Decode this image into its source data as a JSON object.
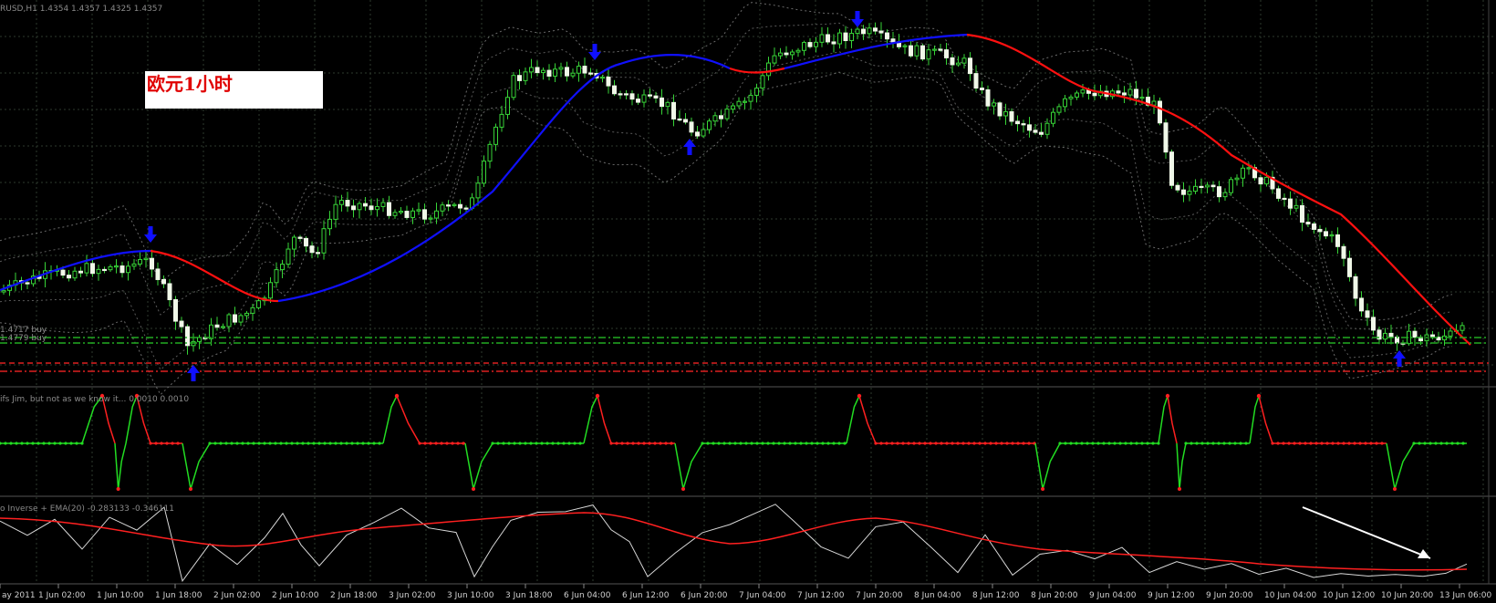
{
  "window": {
    "symbol_header": "RUSD,H1  1.4354  1.4357  1.4325  1.4357",
    "overlay_label": "欧元1小时",
    "buy_label_1": "1.4717 buy",
    "buy_label_2": "1.4779 buy"
  },
  "indicators": {
    "middle_header": "ifs Jim, but not as we know it...  0.0010  0.0010",
    "bottom_header": "o Inverse + EMA(20)  -0.283133  -0.346111"
  },
  "time_axis": {
    "labels": [
      "ay 2011",
      "1 Jun 02:00",
      "1 Jun 10:00",
      "1 Jun 18:00",
      "2 Jun 02:00",
      "2 Jun 10:00",
      "2 Jun 18:00",
      "3 Jun 02:00",
      "3 Jun 10:00",
      "3 Jun 18:00",
      "6 Jun 04:00",
      "6 Jun 12:00",
      "6 Jun 20:00",
      "7 Jun 04:00",
      "7 Jun 12:00",
      "7 Jun 20:00",
      "8 Jun 04:00",
      "8 Jun 12:00",
      "8 Jun 20:00",
      "9 Jun 04:00",
      "9 Jun 12:00",
      "9 Jun 20:00",
      "10 Jun 04:00",
      "10 Jun 12:00",
      "10 Jun 20:00",
      "13 Jun 06:00"
    ]
  },
  "colors": {
    "bg": "#000000",
    "grid": "#2e3a2e",
    "bull": "#f0f8e8",
    "bear": "#f0f8e8",
    "wick": "#37d437",
    "ma_up": "#1010ff",
    "ma_down": "#ff1010",
    "arrow": "#1010ff",
    "osc_green": "#22dd22",
    "osc_red": "#ff2020",
    "line_white": "#d8d8d8",
    "ema_red": "#ff2020",
    "buy_line": "#22aa22",
    "sell_line": "#dd2020"
  },
  "icons": {
    "down_arrow": "arrow-down-icon",
    "up_arrow": "arrow-up-icon"
  }
}
